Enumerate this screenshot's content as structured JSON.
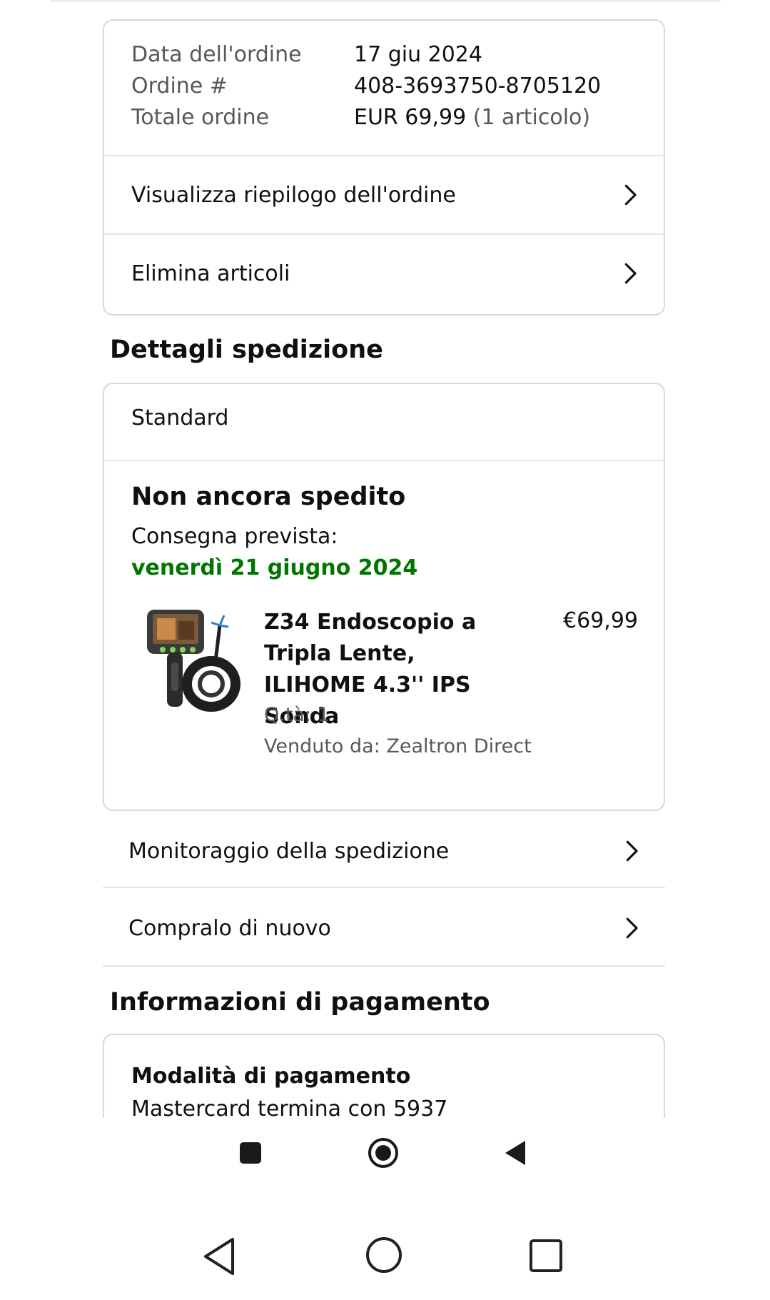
{
  "order": {
    "date_label": "Data dell'ordine",
    "date_value": "17 giu 2024",
    "number_label": "Ordine #",
    "number_value": "408-3693750-8705120",
    "total_label": "Totale ordine",
    "total_value": "EUR 69,99",
    "total_items": "(1 articolo)",
    "summary_link": "Visualizza riepilogo dell'ordine",
    "delete_link": "Elimina articoli"
  },
  "shipping": {
    "section_title": "Dettagli spedizione",
    "type": "Standard",
    "status": "Non ancora spedito",
    "expected_label": "Consegna prevista:",
    "expected_date": "venerdì 21 giugno 2024",
    "product": {
      "title": "Z34 Endoscopio a Tripla Lente, ILIHOME 4.3'' IPS Sonda",
      "price": "€69,99",
      "qty": "Q.tà: 1",
      "seller": "Venduto da: Zealtron Direct"
    },
    "track_link": "Monitoraggio della spedizione",
    "buy_again_link": "Compralo di nuovo"
  },
  "payment": {
    "section_title": "Informazioni di pagamento",
    "method_label": "Modalità di pagamento",
    "method_value": "Mastercard  termina con 5937"
  },
  "colors": {
    "delivery_green": "#007600",
    "border": "#d5d9d9",
    "muted_text": "#565959"
  },
  "icons": {
    "row_chevron": "chevron-right-icon",
    "app_nav": [
      "stop-square-icon",
      "record-circle-icon",
      "back-triangle-icon"
    ],
    "system_nav": [
      "back-icon",
      "home-icon",
      "recents-icon"
    ]
  }
}
